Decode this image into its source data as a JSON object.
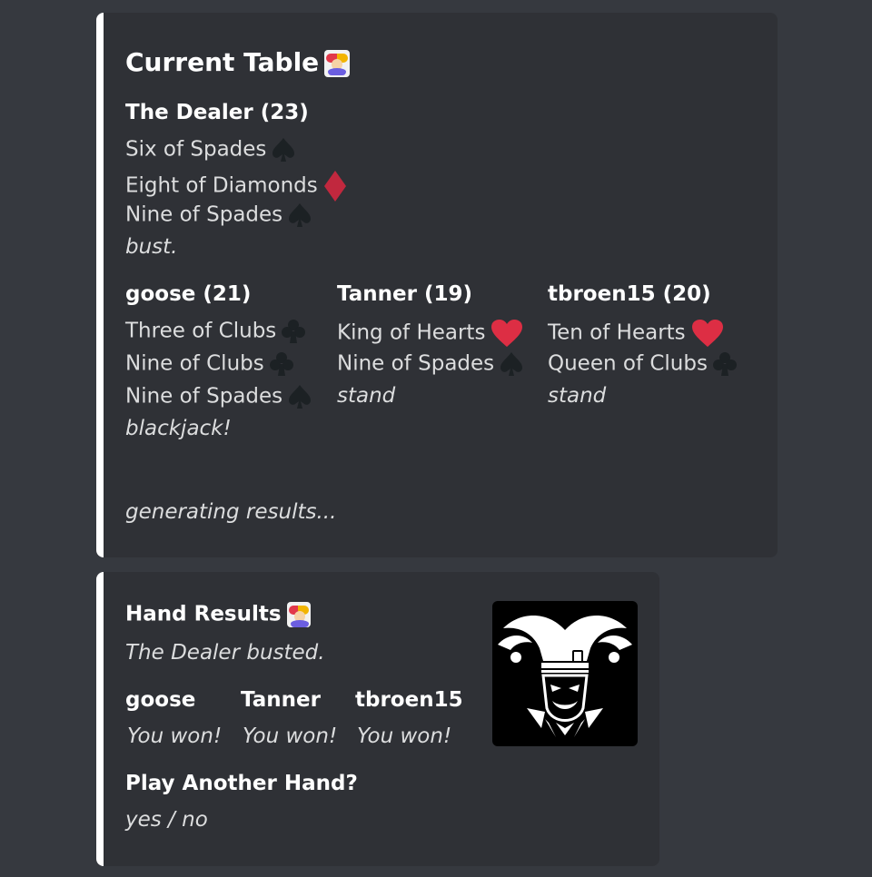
{
  "table": {
    "title": "Current Table",
    "dealer": {
      "heading": "The Dealer (23)",
      "cards": [
        {
          "name": "Six of Spades",
          "suit": "spades"
        },
        {
          "name": "Eight of Diamonds",
          "suit": "diamonds"
        },
        {
          "name": "Nine of Spades",
          "suit": "spades"
        }
      ],
      "status": "bust."
    },
    "players": [
      {
        "heading": "goose (21)",
        "cards": [
          {
            "name": "Three of Clubs",
            "suit": "clubs"
          },
          {
            "name": "Nine of Clubs",
            "suit": "clubs"
          },
          {
            "name": "Nine of Spades",
            "suit": "spades"
          }
        ],
        "status": "blackjack!"
      },
      {
        "heading": "Tanner (19)",
        "cards": [
          {
            "name": "King of Hearts",
            "suit": "hearts"
          },
          {
            "name": "Nine of Spades",
            "suit": "spades"
          }
        ],
        "status": "stand"
      },
      {
        "heading": "tbroen15 (20)",
        "cards": [
          {
            "name": "Ten of Hearts",
            "suit": "hearts"
          },
          {
            "name": "Queen of Clubs",
            "suit": "clubs"
          }
        ],
        "status": "stand"
      }
    ],
    "footer": "generating results..."
  },
  "results": {
    "title": "Hand Results",
    "summary": "The Dealer busted.",
    "players": [
      {
        "name": "goose",
        "result": "You won!"
      },
      {
        "name": "Tanner",
        "result": "You won!"
      },
      {
        "name": "tbroen15",
        "result": "You won!"
      }
    ],
    "prompt_title": "Play Another Hand?",
    "prompt_options": "yes / no"
  },
  "icons": {
    "title_emoji": "joker-card-icon",
    "thumbnail": "jester-mask-icon",
    "spades": "spade-icon",
    "clubs": "club-icon",
    "hearts": "heart-icon",
    "diamonds": "diamond-icon"
  },
  "colors": {
    "background": "#36393f",
    "embed": "#2f3136",
    "embed_border": "#ffffff",
    "heart": "#dd2e44",
    "diamond": "#c1283e",
    "dark_suit": "#1c2124"
  }
}
